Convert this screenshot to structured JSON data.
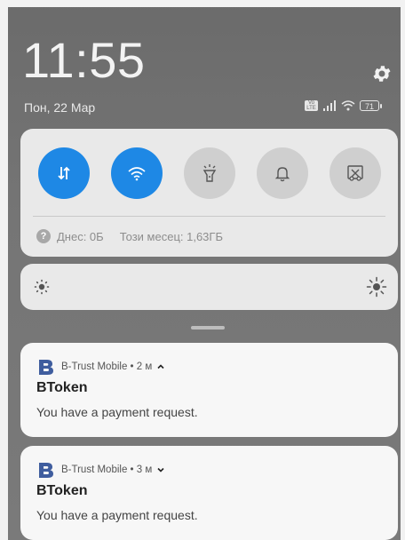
{
  "statusbar": {
    "time": "11:55",
    "date": "Пон, 22 Мар",
    "battery_level": "71",
    "volte_label": "Vo LTE"
  },
  "quick_settings": {
    "toggles": [
      {
        "name": "mobile-data",
        "state": "on",
        "icon": "data-transfer-icon"
      },
      {
        "name": "wifi",
        "state": "on",
        "icon": "wifi-icon"
      },
      {
        "name": "flashlight",
        "state": "off",
        "icon": "flashlight-icon"
      },
      {
        "name": "sound",
        "state": "off",
        "icon": "bell-icon"
      },
      {
        "name": "screenshot",
        "state": "off",
        "icon": "screenshot-icon"
      }
    ],
    "usage_today": "Днес: 0Б",
    "usage_month": "Този месец: 1,63ГБ",
    "help_glyph": "?"
  },
  "brightness": {
    "level": 0.0,
    "low_icon": "brightness-low-icon",
    "high_icon": "brightness-high-icon"
  },
  "notifications": [
    {
      "app": "B-Trust Mobile",
      "time": "2 м",
      "expanded": true,
      "title": "BToken",
      "text": "You have a payment request."
    },
    {
      "app": "B-Trust Mobile",
      "time": "3 м",
      "expanded": false,
      "title": "BToken",
      "text": "You have a payment request."
    }
  ],
  "colors": {
    "accent": "#1e88e5",
    "panel": "#e9e9e9",
    "card": "#f7f7f7",
    "logo": "#3f5d9e"
  }
}
